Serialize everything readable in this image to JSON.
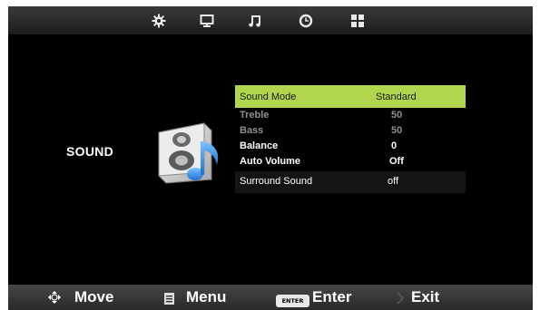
{
  "tabs": [
    {
      "icon": "gear-icon"
    },
    {
      "icon": "monitor-icon"
    },
    {
      "icon": "music-note-icon"
    },
    {
      "icon": "clock-icon"
    },
    {
      "icon": "grid-icon"
    }
  ],
  "section": {
    "title": "SOUND",
    "icon": "speaker-note-icon"
  },
  "menu": {
    "sound_mode": {
      "label": "Sound Mode",
      "value": "Standard"
    },
    "treble": {
      "label": "Treble",
      "value": "50"
    },
    "bass": {
      "label": "Bass",
      "value": "50"
    },
    "balance": {
      "label": "Balance",
      "value": "0"
    },
    "auto_volume": {
      "label": "Auto Volume",
      "value": "Off"
    },
    "surround_sound": {
      "label": "Surround Sound",
      "value": "off"
    }
  },
  "footer": {
    "move": "Move",
    "menu": "Menu",
    "enter_key": "ENTER",
    "enter": "Enter",
    "exit": "Exit"
  },
  "colors": {
    "highlight": "#b0d64e",
    "background": "#000000",
    "disabled": "#8f8f8f"
  }
}
